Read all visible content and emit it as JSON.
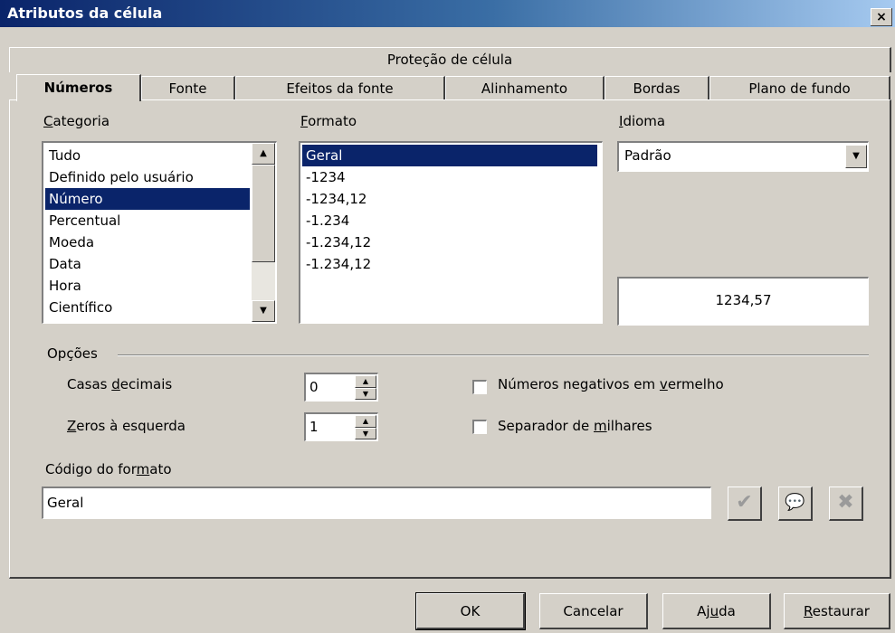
{
  "window": {
    "title": "Atributos da célula",
    "close_label": "×"
  },
  "tabs": {
    "row1": [
      {
        "label": "Proteção de célula"
      }
    ],
    "row2": [
      {
        "label": "Números"
      },
      {
        "label": "Fonte"
      },
      {
        "label": "Efeitos da fonte"
      },
      {
        "label": "Alinhamento"
      },
      {
        "label": "Bordas"
      },
      {
        "label": "Plano de fundo"
      }
    ],
    "active": "Números"
  },
  "categoria": {
    "label_prefix": "",
    "label_accel": "C",
    "label_rest": "ategoria",
    "items": [
      "Tudo",
      "Definido pelo usuário",
      "Número",
      "Percentual",
      "Moeda",
      "Data",
      "Hora",
      "Científico"
    ],
    "selected": "Número"
  },
  "formato": {
    "label_accel": "F",
    "label_rest": "ormato",
    "items": [
      "Geral",
      "-1234",
      "-1234,12",
      "-1.234",
      "-1.234,12",
      "-1.234,12"
    ],
    "selected": "Geral"
  },
  "idioma": {
    "label_accel": "I",
    "label_rest": "dioma",
    "value": "Padrão"
  },
  "preview": {
    "value": "1234,57"
  },
  "opcoes": {
    "label": "Opções",
    "casas_decimais": {
      "label_a": "Casas ",
      "label_accel": "d",
      "label_b": "ecimais",
      "value": "0"
    },
    "zeros_esquerda": {
      "label_accel": "Z",
      "label_b": "eros à esquerda",
      "value": "1"
    },
    "negativos": {
      "label_a": "Números negativos em ",
      "label_accel": "v",
      "label_b": "ermelho",
      "checked": false
    },
    "milhares": {
      "label_a": "Separador de ",
      "label_accel": "m",
      "label_b": "ilhares",
      "checked": false
    }
  },
  "codigo": {
    "label_a": "Código do for",
    "label_accel": "m",
    "label_b": "ato",
    "value": "Geral"
  },
  "buttons": {
    "ok": "OK",
    "cancelar": "Cancelar",
    "ajuda_a": "Aj",
    "ajuda_accel": "u",
    "ajuda_b": "da",
    "restaurar_accel": "R",
    "restaurar_b": "estaurar"
  },
  "icons": [
    "check-icon",
    "comment-icon",
    "delete-icon"
  ]
}
